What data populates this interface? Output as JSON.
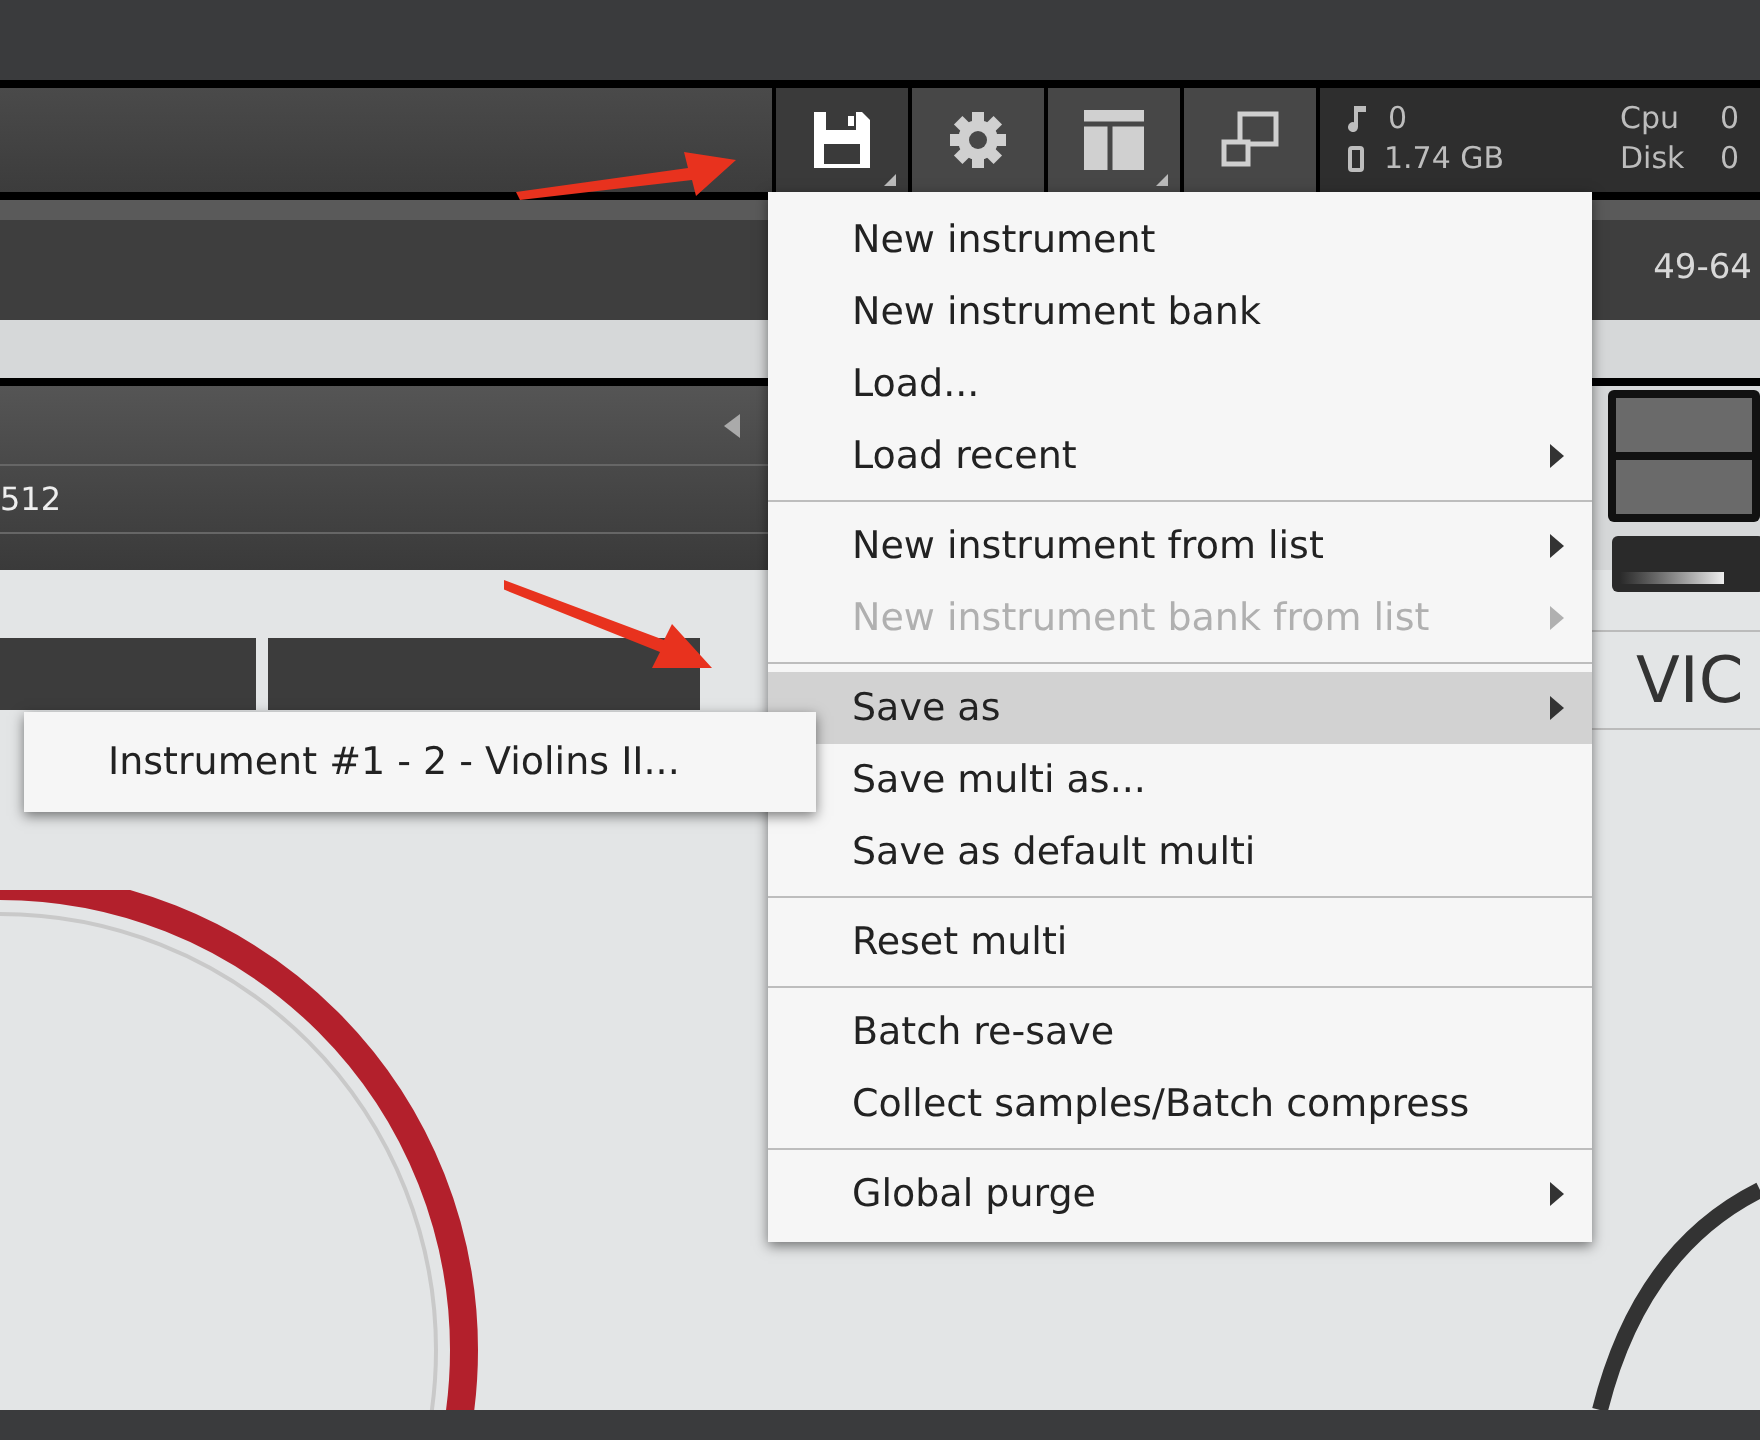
{
  "toolbar": {
    "buttons": [
      {
        "kind": "save",
        "has_menu": true,
        "selected": true
      },
      {
        "kind": "settings",
        "has_menu": false,
        "selected": false
      },
      {
        "kind": "layout",
        "has_menu": true,
        "selected": false
      },
      {
        "kind": "resize",
        "has_menu": false,
        "selected": false
      }
    ],
    "stats": {
      "voices": "0",
      "memory": "1.74 GB",
      "cpu_label": "Cpu",
      "cpu_value": "0",
      "disk_label": "Disk",
      "disk_value": "0"
    }
  },
  "rack_header": {
    "channels": "49-64"
  },
  "instrument_panel": {
    "row_value": "512"
  },
  "instrument_title": "VIC",
  "volume": {
    "level": 0.72
  },
  "menu": {
    "sections": [
      [
        {
          "label": "New instrument",
          "submenu": false,
          "disabled": false,
          "selected": false
        },
        {
          "label": "New instrument bank",
          "submenu": false,
          "disabled": false,
          "selected": false
        },
        {
          "label": "Load...",
          "submenu": false,
          "disabled": false,
          "selected": false
        },
        {
          "label": "Load recent",
          "submenu": true,
          "disabled": false,
          "selected": false
        }
      ],
      [
        {
          "label": "New instrument from list",
          "submenu": true,
          "disabled": false,
          "selected": false
        },
        {
          "label": "New instrument bank from list",
          "submenu": true,
          "disabled": true,
          "selected": false
        }
      ],
      [
        {
          "label": "Save as",
          "submenu": true,
          "disabled": false,
          "selected": true
        },
        {
          "label": "Save multi as...",
          "submenu": false,
          "disabled": false,
          "selected": false
        },
        {
          "label": "Save as default multi",
          "submenu": false,
          "disabled": false,
          "selected": false
        }
      ],
      [
        {
          "label": "Reset multi",
          "submenu": false,
          "disabled": false,
          "selected": false
        }
      ],
      [
        {
          "label": "Batch re-save",
          "submenu": false,
          "disabled": false,
          "selected": false
        },
        {
          "label": "Collect samples/Batch compress",
          "submenu": false,
          "disabled": false,
          "selected": false
        }
      ],
      [
        {
          "label": "Global purge",
          "submenu": true,
          "disabled": false,
          "selected": false
        }
      ]
    ]
  },
  "submenu": {
    "items": [
      {
        "label": "Instrument #1 - 2 - Violins II...",
        "selected": false
      }
    ]
  }
}
